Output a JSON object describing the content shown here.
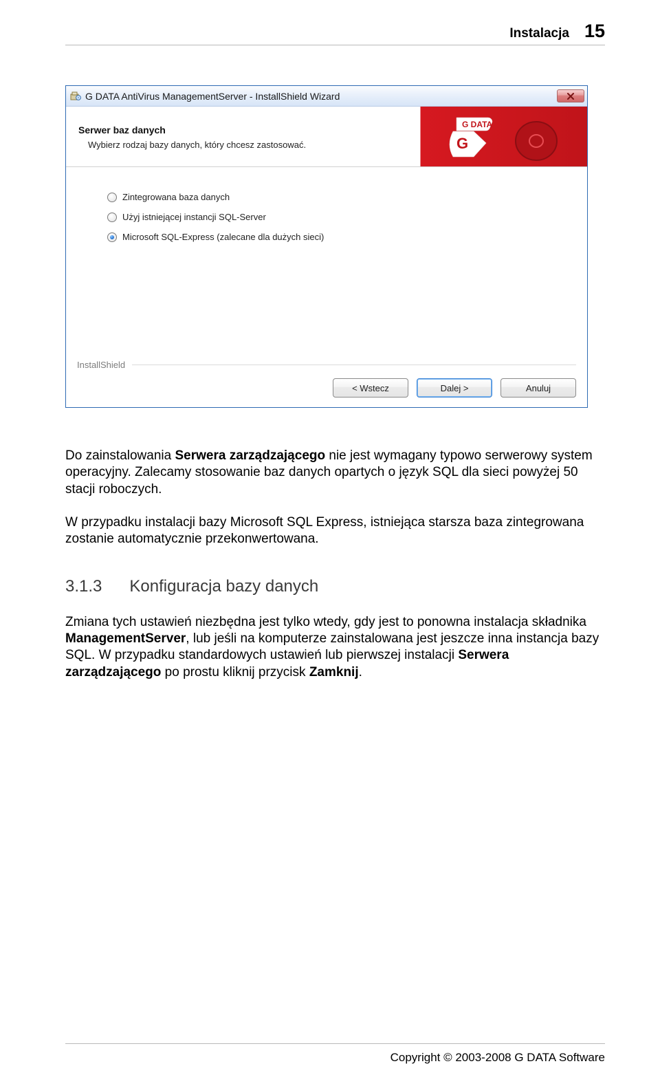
{
  "header": {
    "title": "Instalacja",
    "page_number": "15"
  },
  "window": {
    "title": "G DATA AntiVirus ManagementServer - InstallShield Wizard",
    "close_label": "X",
    "heading": "Serwer baz danych",
    "subheading": "Wybierz rodzaj bazy danych, który chcesz zastosować.",
    "options": [
      "Zintegrowana baza danych",
      "Użyj istniejącej instancji SQL-Server",
      "Microsoft SQL-Express (zalecane dla dużych sieci)"
    ],
    "installshield_label": "InstallShield",
    "buttons": {
      "back": "< Wstecz",
      "next": "Dalej >",
      "cancel": "Anuluj"
    },
    "logo_text_top": "G DATA"
  },
  "body": {
    "para1_a": "Do zainstalowania ",
    "para1_b": "Serwera zarządzającego",
    "para1_c": " nie jest wymagany typowo serwerowy system operacyjny. Zalecamy stosowanie baz danych opartych o język SQL dla sieci powyżej 50 stacji roboczych.",
    "para2": "W przypadku instalacji bazy Microsoft SQL Express, istniejąca starsza baza zintegrowana zostanie automatycznie przekonwertowana.",
    "section_num": "3.1.3",
    "section_title": "Konfiguracja bazy danych",
    "para3_a": "Zmiana tych ustawień niezbędna jest tylko wtedy, gdy jest to ponowna instalacja składnika ",
    "para3_b": "ManagementServer",
    "para3_c": ", lub jeśli na komputerze zainstalowana jest jeszcze inna instancja bazy SQL. W przypadku standardowych ustawień lub pierwszej instalacji ",
    "para3_d": "Serwera zarządzającego",
    "para3_e": " po prostu kliknij przycisk ",
    "para3_f": "Zamknij",
    "para3_g": "."
  },
  "footer": {
    "copyright": "Copyright © 2003-2008 G DATA Software"
  }
}
